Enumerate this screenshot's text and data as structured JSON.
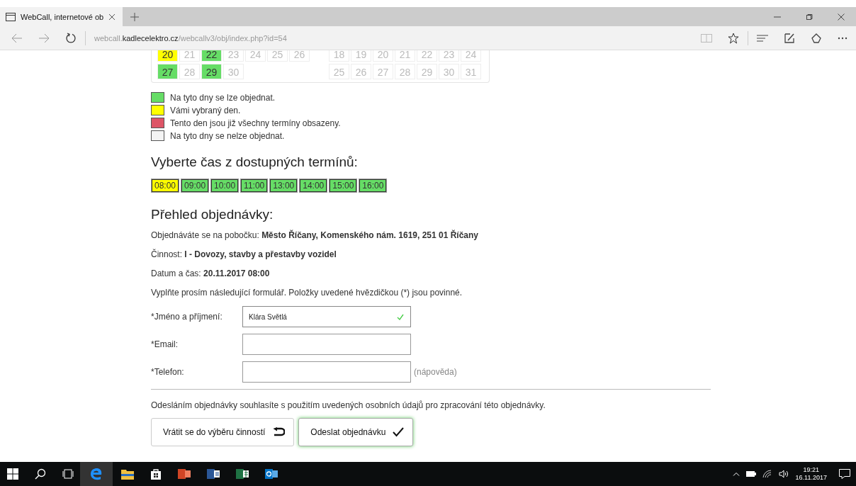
{
  "browser": {
    "tab_title": "WebCall, internetové ob",
    "url_host_prefix": "webcall.",
    "url_domain": "kadlecelektro.cz",
    "url_path": "/webcallv3/obj/index.php?id=54"
  },
  "calendar": {
    "months": [
      {
        "weeks": [
          [
            {
              "day": "20",
              "kind": "selected"
            },
            {
              "day": "21",
              "kind": "closed"
            },
            {
              "day": "22",
              "kind": "open"
            },
            {
              "day": "23",
              "kind": "closed"
            },
            {
              "day": "24",
              "kind": "closed"
            },
            {
              "day": "25",
              "kind": "closed"
            },
            {
              "day": "26",
              "kind": "closed"
            }
          ],
          [
            {
              "day": "27",
              "kind": "open"
            },
            {
              "day": "28",
              "kind": "closed"
            },
            {
              "day": "29",
              "kind": "open"
            },
            {
              "day": "30",
              "kind": "closed"
            }
          ]
        ]
      },
      {
        "weeks": [
          [
            {
              "day": "18",
              "kind": "closed"
            },
            {
              "day": "19",
              "kind": "closed"
            },
            {
              "day": "20",
              "kind": "closed"
            },
            {
              "day": "21",
              "kind": "closed"
            },
            {
              "day": "22",
              "kind": "closed"
            },
            {
              "day": "23",
              "kind": "closed"
            },
            {
              "day": "24",
              "kind": "closed"
            }
          ],
          [
            {
              "day": "25",
              "kind": "closed"
            },
            {
              "day": "26",
              "kind": "closed"
            },
            {
              "day": "27",
              "kind": "closed"
            },
            {
              "day": "28",
              "kind": "closed"
            },
            {
              "day": "29",
              "kind": "closed"
            },
            {
              "day": "30",
              "kind": "closed"
            },
            {
              "day": "31",
              "kind": "closed"
            }
          ]
        ]
      }
    ]
  },
  "legend": [
    {
      "color": "#66dd66",
      "text": "Na tyto dny se lze objednat."
    },
    {
      "color": "#ffff00",
      "text": "Vámi vybraný den."
    },
    {
      "color": "#dd5566",
      "text": "Tento den jsou již všechny termíny obsazeny."
    },
    {
      "color": "#f4f4f4",
      "text": "Na tyto dny se nelze objednat."
    }
  ],
  "time_heading": "Vyberte čas z dostupných termínů:",
  "time_slots": [
    {
      "label": "08:00",
      "selected": true
    },
    {
      "label": "09:00",
      "selected": false
    },
    {
      "label": "10:00",
      "selected": false
    },
    {
      "label": "11:00",
      "selected": false
    },
    {
      "label": "13:00",
      "selected": false
    },
    {
      "label": "14:00",
      "selected": false
    },
    {
      "label": "15:00",
      "selected": false
    },
    {
      "label": "16:00",
      "selected": false
    }
  ],
  "summary_heading": "Přehled objednávky:",
  "summary_lines": [
    "Objednáváte se na pobočku: **Město Říčany, Komenského nám. 1619, 251 01 Říčany**",
    "Činnost: **I - Dovozy, stavby a přestavby vozidel**",
    "Datum a čas: **20.11.2017 08:00**",
    "Vyplňte prosím následující formulář. Položky uvedené hvězdičkou (*) jsou povinné."
  ],
  "form_fields": [
    {
      "label": "*Jméno a příjmení:",
      "value": "Klára Světlá",
      "valid": true
    },
    {
      "label": "*Email:",
      "valid": false
    },
    {
      "label": "*Telefon:",
      "valid": false,
      "help": "(nápověda)"
    }
  ],
  "consent": "Odesláním objednávky souhlasíte s použitím uvedených osobních údajů pro zpracování této objednávky.",
  "buttons": [
    {
      "kind": "back",
      "label": "Vrátit se do výběru činností"
    },
    {
      "kind": "submit",
      "label": "Odeslat objednávku"
    }
  ],
  "taskbar": {
    "time": "19:21",
    "date": "16.11.2017"
  }
}
